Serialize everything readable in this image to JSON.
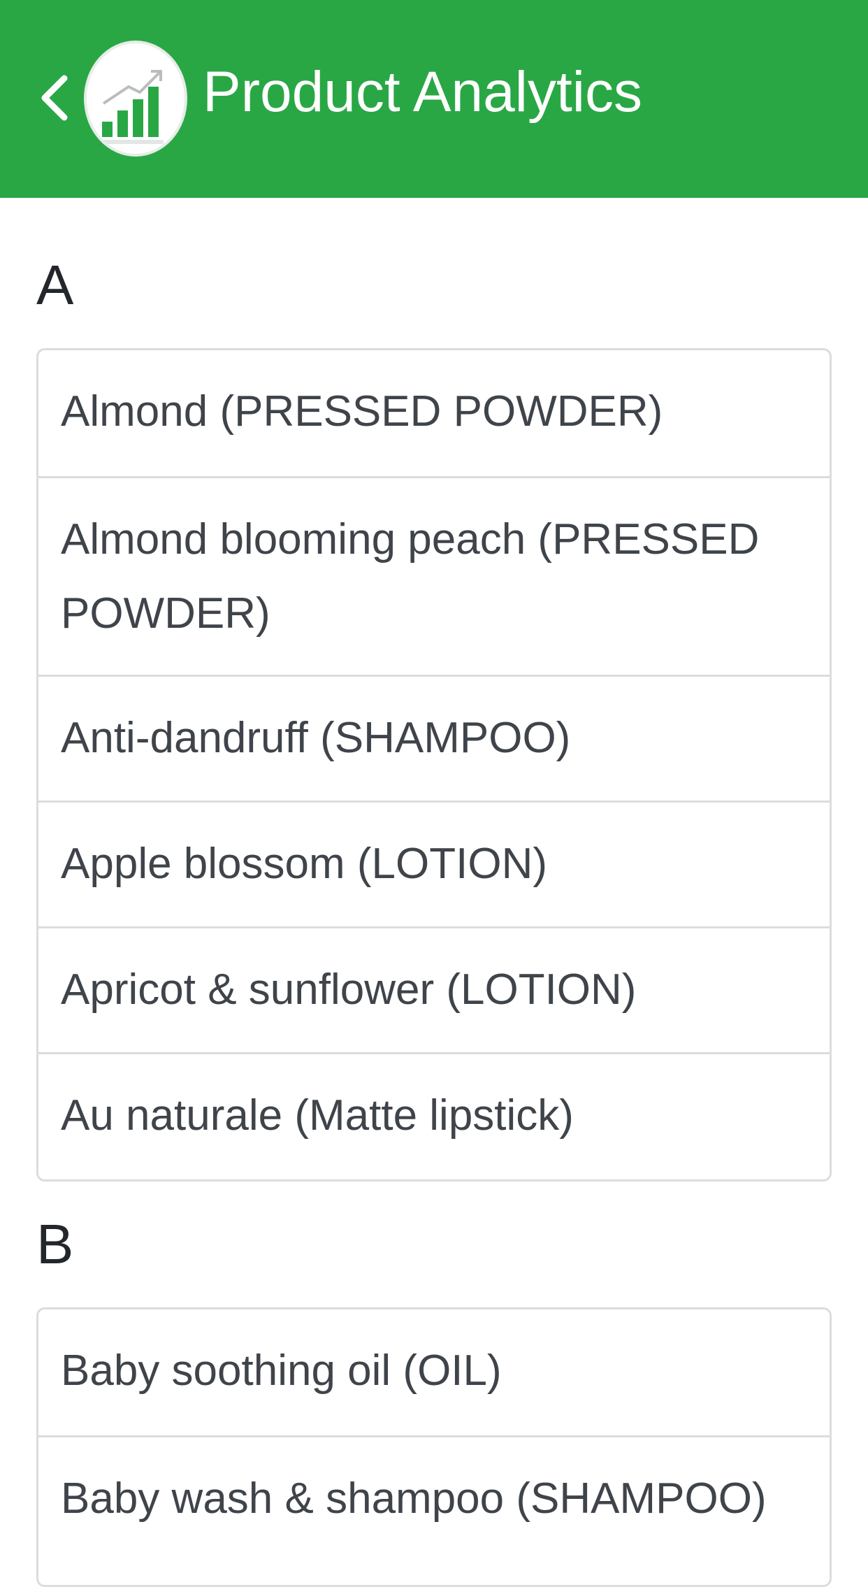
{
  "header": {
    "title": "Product Analytics",
    "back_icon": "chevron-left-icon",
    "logo_icon": "bar-chart-growth-icon",
    "background_color": "#2aa745"
  },
  "sections": [
    {
      "letter": "A",
      "items": [
        "Almond (PRESSED POWDER)",
        "Almond blooming peach (PRESSED POWDER)",
        "Anti-dandruff (SHAMPOO)",
        "Apple blossom (LOTION)",
        "Apricot & sunflower (LOTION)",
        "Au naturale (Matte lipstick)"
      ]
    },
    {
      "letter": "B",
      "items": [
        "Baby soothing oil (OIL)",
        "Baby wash & shampoo (SHAMPOO)"
      ]
    }
  ]
}
